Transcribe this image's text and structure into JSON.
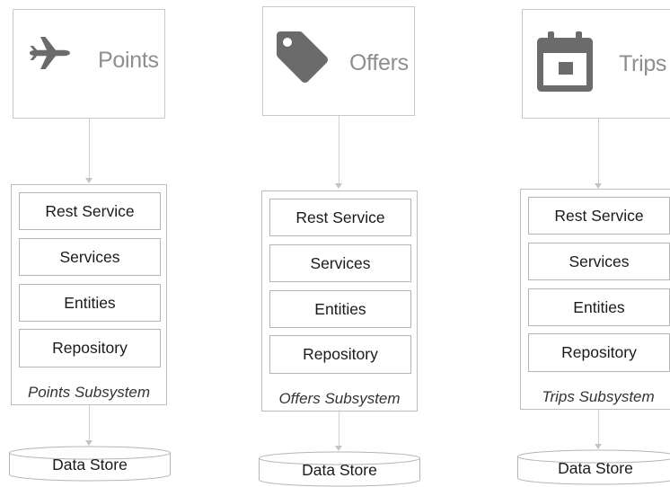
{
  "columns": [
    {
      "app_label": "Points",
      "icon": "airplane-icon",
      "layers": [
        "Rest Service",
        "Services",
        "Entities",
        "Repository"
      ],
      "subsystem_label": "Points Subsystem",
      "store_label": "Data Store"
    },
    {
      "app_label": "Offers",
      "icon": "tag-icon",
      "layers": [
        "Rest Service",
        "Services",
        "Entities",
        "Repository"
      ],
      "subsystem_label": "Offers Subsystem",
      "store_label": "Data Store"
    },
    {
      "app_label": "Trips",
      "icon": "calendar-icon",
      "layers": [
        "Rest Service",
        "Services",
        "Entities",
        "Repository"
      ],
      "subsystem_label": "Trips Subsystem",
      "store_label": "Data Store"
    }
  ],
  "colors": {
    "icon": "#6b6b6b",
    "app_label": "#8e8e8e",
    "border": "#bdbdbd"
  }
}
